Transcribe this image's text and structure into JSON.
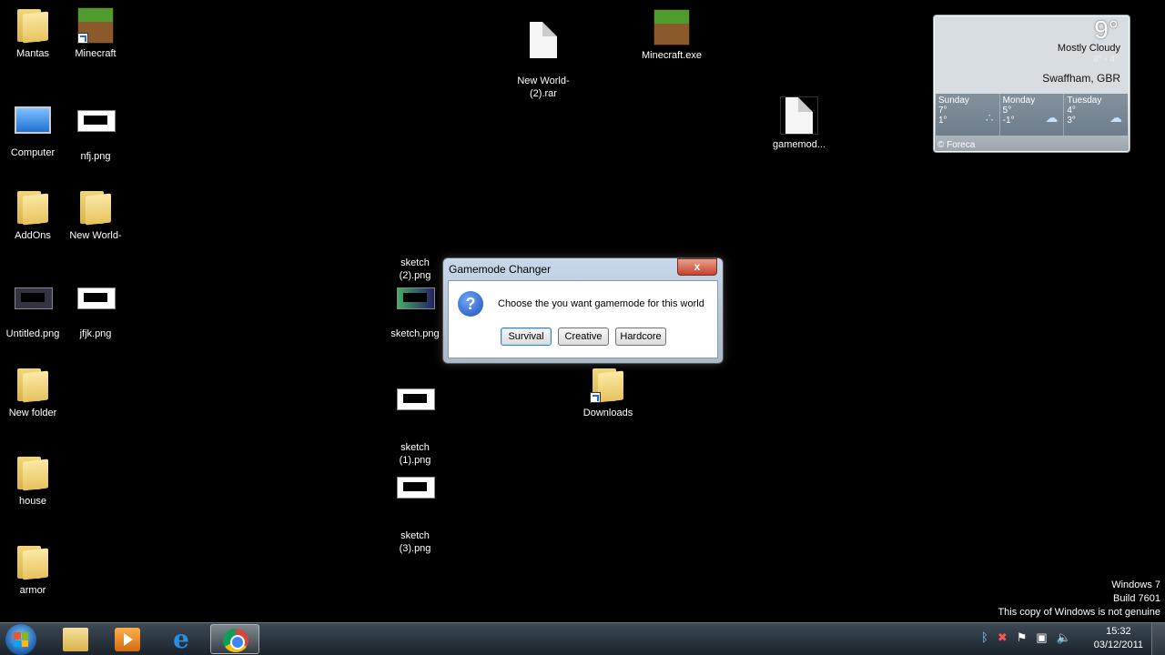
{
  "desktop": {
    "icons": [
      {
        "label": "Mantas"
      },
      {
        "label": "Minecraft"
      },
      {
        "label": "Computer"
      },
      {
        "label": "nfj.png"
      },
      {
        "label": "AddOns"
      },
      {
        "label": "New World-"
      },
      {
        "label": "Untitled.png"
      },
      {
        "label": "jfjk.png"
      },
      {
        "label": "New folder"
      },
      {
        "label": "house"
      },
      {
        "label": "armor"
      },
      {
        "label": "New World-\n(2).rar"
      },
      {
        "label": "Minecraft.exe"
      },
      {
        "label": "gamemod..."
      },
      {
        "label": "sketch\n(2).png"
      },
      {
        "label": "sketch.png"
      },
      {
        "label": "sketch\n(1).png"
      },
      {
        "label": "sketch\n(3).png"
      },
      {
        "label": "Downloads"
      }
    ]
  },
  "weather": {
    "temp": "9°",
    "condition": "Mostly Cloudy",
    "range": "9° - 4°",
    "city": "Swaffham, GBR",
    "days": [
      {
        "name": "Sunday",
        "hi": "7°",
        "lo": "1°",
        "icon": "rain-icon"
      },
      {
        "name": "Monday",
        "hi": "5°",
        "lo": "-1°",
        "icon": "cloud-icon"
      },
      {
        "name": "Tuesday",
        "hi": "4°",
        "lo": "3°",
        "icon": "cloud-icon"
      }
    ],
    "footer": "© Foreca"
  },
  "dialog": {
    "title": "Gamemode Changer",
    "close": "x",
    "message": "Choose the you want gamemode for this world",
    "buttons": [
      "Survival",
      "Creative",
      "Hardcore"
    ]
  },
  "watermark": {
    "line1": "Windows 7",
    "line2": "Build 7601",
    "line3": "This copy of Windows is not genuine"
  },
  "taskbar": {
    "apps": [
      "Windows Explorer",
      "Windows Media Player",
      "Internet Explorer",
      "Google Chrome"
    ],
    "tray_icons": [
      "bluetooth-icon",
      "network-error-icon",
      "action-center-flag-icon",
      "display-icon",
      "volume-icon"
    ],
    "time": "15:32",
    "date": "03/12/2011"
  }
}
